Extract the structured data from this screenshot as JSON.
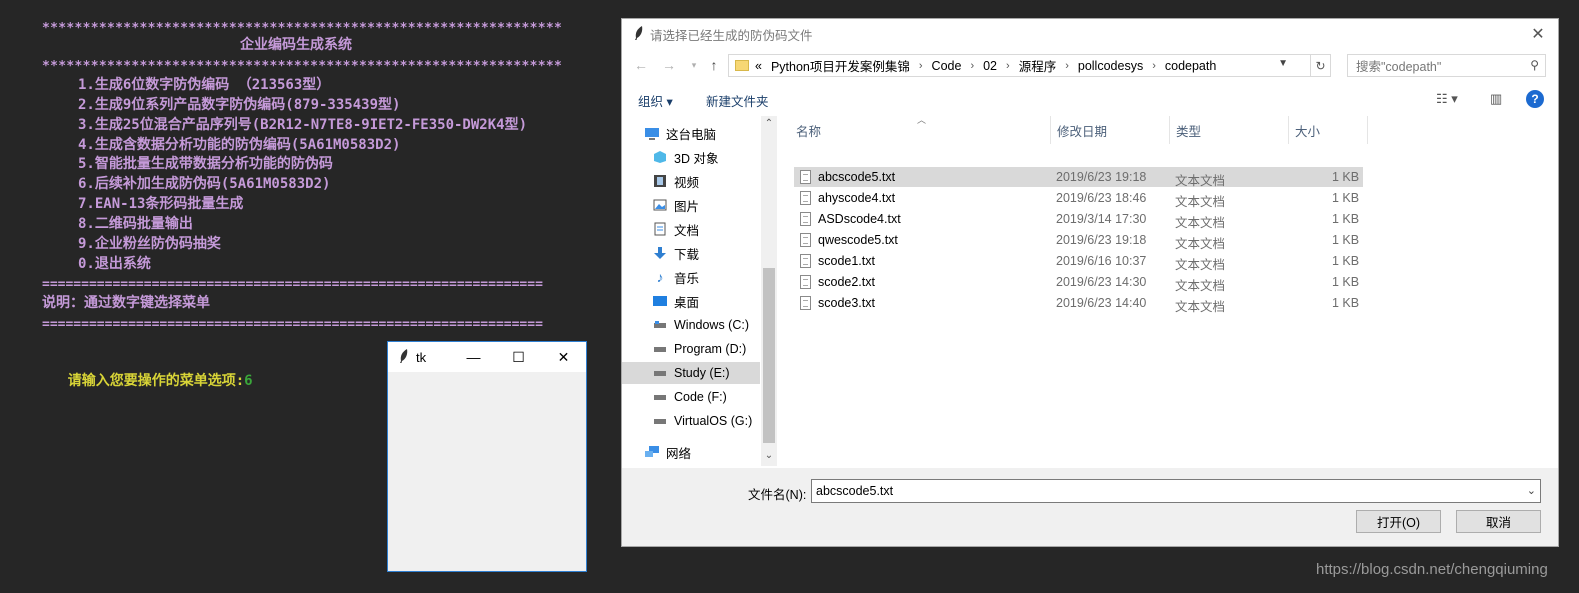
{
  "console": {
    "stars_top": "****************************************************************",
    "title": "企业编码生成系统",
    "stars_mid": "****************************************************************",
    "menu": [
      "1.生成6位数字防伪编码 （213563型）",
      "2.生成9位系列产品数字防伪编码(879-335439型)",
      "3.生成25位混合产品序列号(B2R12-N7TE8-9IET2-FE350-DW2K4型)",
      "4.生成含数据分析功能的防伪编码(5A61M0583D2)",
      "5.智能批量生成带数据分析功能的防伪码",
      "6.后续补加生成防伪码(5A61M0583D2)",
      "7.EAN-13条形码批量生成",
      "8.二维码批量输出",
      "9.企业粉丝防伪码抽奖",
      "0.退出系统"
    ],
    "eq_line": "================================================================",
    "note": "说明：通过数字键选择菜单",
    "prompt": "请输入您要操作的菜单选项:",
    "input_value": "6"
  },
  "tk_window": {
    "title": "tk",
    "min": "—",
    "max": "☐",
    "close": "✕"
  },
  "dialog": {
    "title": "请选择已经生成的防伪码文件",
    "breadcrumb": [
      "«",
      "Python项目开发案例集锦",
      "Code",
      "02",
      "源程序",
      "pollcodesys",
      "codepath"
    ],
    "search_placeholder": "搜索\"codepath\"",
    "toolbar": {
      "organize": "组织 ▾",
      "new_folder": "新建文件夹"
    },
    "tree": [
      {
        "label": "这台电脑",
        "icon": "pc-icon"
      },
      {
        "label": "3D 对象",
        "icon": "cube-icon"
      },
      {
        "label": "视频",
        "icon": "video-icon"
      },
      {
        "label": "图片",
        "icon": "picture-icon"
      },
      {
        "label": "文档",
        "icon": "document-icon"
      },
      {
        "label": "下载",
        "icon": "download-icon"
      },
      {
        "label": "音乐",
        "icon": "music-icon"
      },
      {
        "label": "桌面",
        "icon": "desktop-icon"
      },
      {
        "label": "Windows (C:)",
        "icon": "drive-icon"
      },
      {
        "label": "Program (D:)",
        "icon": "drive-icon"
      },
      {
        "label": "Study (E:)",
        "icon": "drive-icon"
      },
      {
        "label": "Code (F:)",
        "icon": "drive-icon"
      },
      {
        "label": "VirtualOS (G:)",
        "icon": "drive-icon"
      },
      {
        "label": "网络",
        "icon": "network-icon"
      }
    ],
    "columns": [
      "名称",
      "修改日期",
      "类型",
      "大小"
    ],
    "files": [
      {
        "name": "abcscode5.txt",
        "date": "2019/6/23 19:18",
        "type": "文本文档",
        "size": "1 KB"
      },
      {
        "name": "ahyscode4.txt",
        "date": "2019/6/23 18:46",
        "type": "文本文档",
        "size": "1 KB"
      },
      {
        "name": "ASDscode4.txt",
        "date": "2019/3/14 17:30",
        "type": "文本文档",
        "size": "1 KB"
      },
      {
        "name": "qwescode5.txt",
        "date": "2019/6/23 19:18",
        "type": "文本文档",
        "size": "1 KB"
      },
      {
        "name": "scode1.txt",
        "date": "2019/6/16 10:37",
        "type": "文本文档",
        "size": "1 KB"
      },
      {
        "name": "scode2.txt",
        "date": "2019/6/23 14:30",
        "type": "文本文档",
        "size": "1 KB"
      },
      {
        "name": "scode3.txt",
        "date": "2019/6/23 14:40",
        "type": "文本文档",
        "size": "1 KB"
      }
    ],
    "filename_label": "文件名(N):",
    "filename_value": "abcscode5.txt",
    "open_button": "打开(O)",
    "cancel_button": "取消"
  },
  "watermark": "https://blog.csdn.net/chengqiuming"
}
